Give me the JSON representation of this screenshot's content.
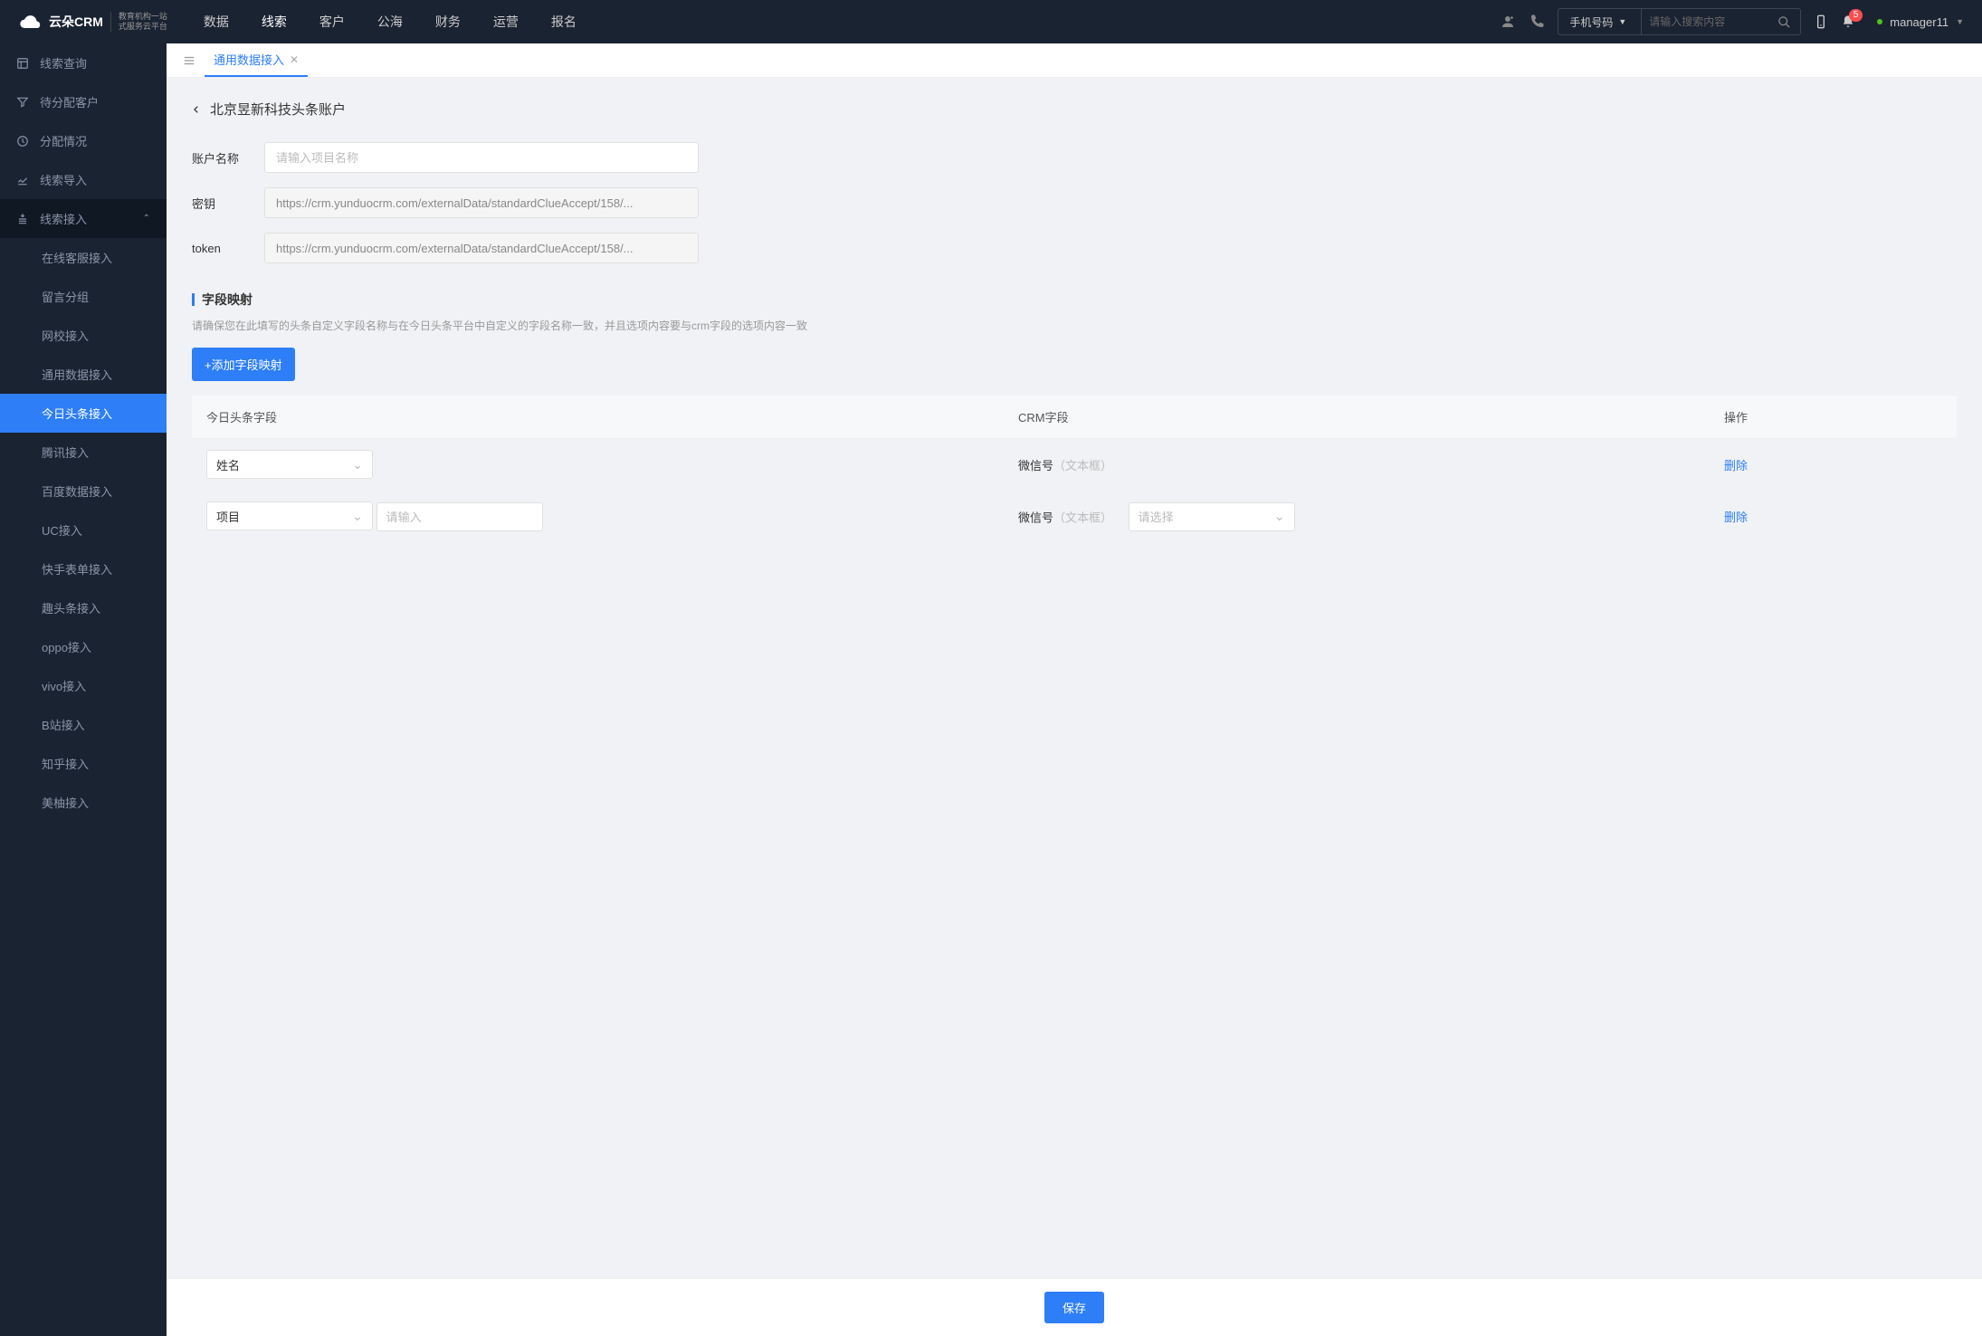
{
  "header": {
    "logo": "云朵CRM",
    "logo_sub1": "教育机构一站",
    "logo_sub2": "式服务云平台",
    "nav": [
      "数据",
      "线索",
      "客户",
      "公海",
      "财务",
      "运营",
      "报名"
    ],
    "nav_active": 1,
    "search_type": "手机号码",
    "search_placeholder": "请输入搜索内容",
    "badge": "5",
    "user": "manager11"
  },
  "sidebar": {
    "items": [
      {
        "label": "线索查询"
      },
      {
        "label": "待分配客户"
      },
      {
        "label": "分配情况"
      },
      {
        "label": "线索导入"
      },
      {
        "label": "线索接入",
        "expanded": true,
        "children": [
          {
            "label": "在线客服接入"
          },
          {
            "label": "留言分组"
          },
          {
            "label": "网校接入"
          },
          {
            "label": "通用数据接入"
          },
          {
            "label": "今日头条接入",
            "active": true
          },
          {
            "label": "腾讯接入"
          },
          {
            "label": "百度数据接入"
          },
          {
            "label": "UC接入"
          },
          {
            "label": "快手表单接入"
          },
          {
            "label": "趣头条接入"
          },
          {
            "label": "oppo接入"
          },
          {
            "label": "vivo接入"
          },
          {
            "label": "B站接入"
          },
          {
            "label": "知乎接入"
          },
          {
            "label": "美柚接入"
          }
        ]
      }
    ]
  },
  "tabs": {
    "active": "通用数据接入"
  },
  "page": {
    "title": "北京昱新科技头条账户",
    "form": {
      "account_label": "账户名称",
      "account_placeholder": "请输入项目名称",
      "secret_label": "密钥",
      "secret_value": "https://crm.yunduocrm.com/externalData/standardClueAccept/158/...",
      "token_label": "token",
      "token_value": "https://crm.yunduocrm.com/externalData/standardClueAccept/158/..."
    },
    "section_title": "字段映射",
    "section_desc": "请确保您在此填写的头条自定义字段名称与在今日头条平台中自定义的字段名称一致，并且选项内容要与crm字段的选项内容一致",
    "add_button": "+添加字段映射",
    "table": {
      "headers": [
        "今日头条字段",
        "CRM字段",
        "操作"
      ],
      "rows": [
        {
          "field": "姓名",
          "crm_label": "微信号",
          "crm_type": "（文本框）",
          "has_input": false,
          "has_select": false
        },
        {
          "field": "项目",
          "crm_label": "微信号",
          "crm_type": "（文本框）",
          "has_input": true,
          "input_placeholder": "请输入",
          "has_select": true,
          "select_placeholder": "请选择"
        }
      ],
      "delete_label": "删除"
    },
    "save": "保存"
  }
}
